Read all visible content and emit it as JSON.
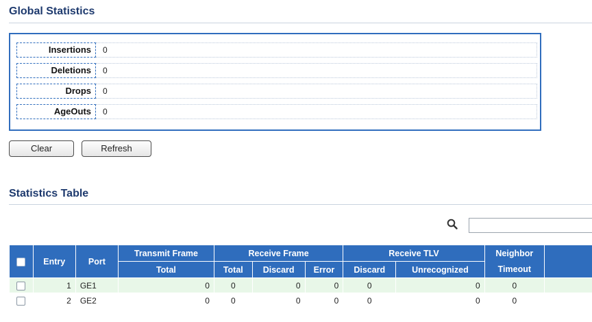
{
  "global_statistics": {
    "title": "Global Statistics",
    "rows": [
      {
        "label": "Insertions",
        "value": "0"
      },
      {
        "label": "Deletions",
        "value": "0"
      },
      {
        "label": "Drops",
        "value": "0"
      },
      {
        "label": "AgeOuts",
        "value": "0"
      }
    ],
    "buttons": {
      "clear": "Clear",
      "refresh": "Refresh"
    }
  },
  "statistics_table": {
    "title": "Statistics Table",
    "search": {
      "placeholder": "",
      "value": ""
    },
    "headers": {
      "entry": "Entry",
      "port": "Port",
      "transmit_frame": "Transmit Frame",
      "transmit_total": "Total",
      "receive_frame": "Receive Frame",
      "receive_total": "Total",
      "receive_discard": "Discard",
      "receive_error": "Error",
      "receive_tlv": "Receive TLV",
      "tlv_discard": "Discard",
      "tlv_unrecognized": "Unrecognized",
      "neighbor_timeout_line1": "Neighbor",
      "neighbor_timeout_line2": "Timeout"
    },
    "rows": [
      {
        "entry": "1",
        "port": "GE1",
        "transmit_total": "0",
        "receive_total": "0",
        "receive_discard": "0",
        "receive_error": "0",
        "tlv_discard": "0",
        "tlv_unrecognized": "0",
        "neighbor_timeout": "0"
      },
      {
        "entry": "2",
        "port": "GE2",
        "transmit_total": "0",
        "receive_total": "0",
        "receive_discard": "0",
        "receive_error": "0",
        "tlv_discard": "0",
        "tlv_unrecognized": "0",
        "neighbor_timeout": "0"
      }
    ]
  },
  "colors": {
    "header_blue": "#2f6dbd",
    "title_navy": "#1e3a6e",
    "row_highlight": "#e8f7e8"
  }
}
